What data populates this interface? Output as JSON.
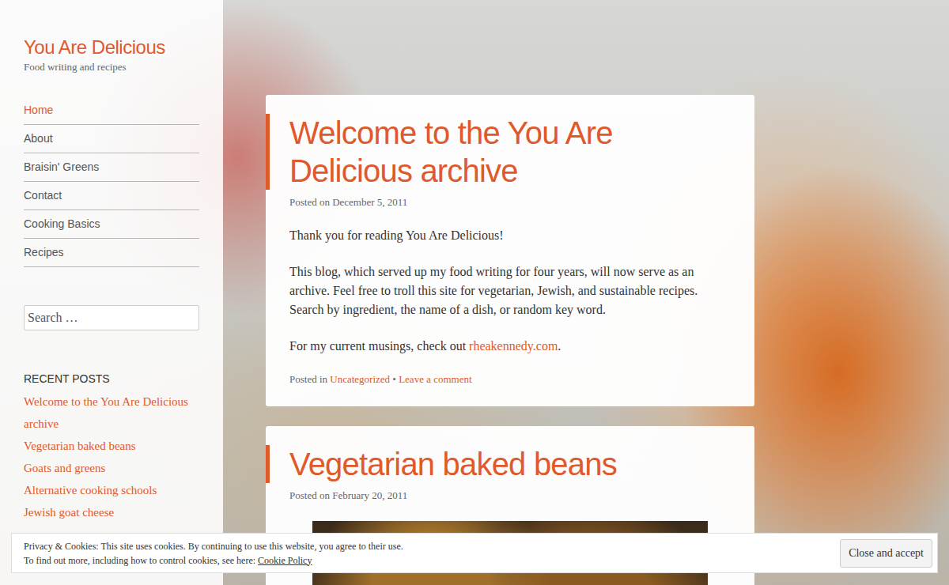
{
  "site": {
    "title": "You Are Delicious",
    "tagline": "Food writing and recipes"
  },
  "nav": [
    {
      "label": "Home",
      "selected": true
    },
    {
      "label": "About",
      "selected": false
    },
    {
      "label": "Braisin' Greens",
      "selected": false
    },
    {
      "label": "Contact",
      "selected": false
    },
    {
      "label": "Cooking Basics",
      "selected": false
    },
    {
      "label": "Recipes",
      "selected": false
    }
  ],
  "search": {
    "placeholder": "Search …"
  },
  "recent_posts": {
    "heading": "RECENT POSTS",
    "items": [
      "Welcome to the You Are Delicious archive",
      "Vegetarian baked beans",
      "Goats and greens",
      "Alternative cooking schools",
      "Jewish goat cheese"
    ]
  },
  "posts": [
    {
      "title": "Welcome to the You Are Delicious archive",
      "meta": "Posted on December 5, 2011",
      "image": false,
      "paragraphs": [
        [
          {
            "text": "Thank you for reading You Are Delicious!",
            "link": false
          }
        ],
        [
          {
            "text": "This blog, which served up my food writing for four years, will now serve as an archive. Feel free to troll this site for vegetarian, Jewish, and sustainable recipes. Search by ingredient, the name of a dish, or random key word.",
            "link": false
          }
        ],
        [
          {
            "text": "For my current musings, check out ",
            "link": false
          },
          {
            "text": "rheakennedy.com",
            "link": true
          },
          {
            "text": ".",
            "link": false
          }
        ]
      ],
      "footer": {
        "prefix": "Posted in ",
        "category": "Uncategorized",
        "separator": " • ",
        "comment": "Leave a comment"
      }
    },
    {
      "title": "Vegetarian baked beans",
      "meta": "Posted on February 20, 2011",
      "image": true,
      "paragraphs": [],
      "footer": null
    }
  ],
  "cookie": {
    "line1": "Privacy & Cookies: This site uses cookies. By continuing to use this website, you agree to their use.",
    "line2": "To find out more, including how to control cookies, see here: ",
    "link": "Cookie Policy",
    "button": "Close and accept"
  }
}
